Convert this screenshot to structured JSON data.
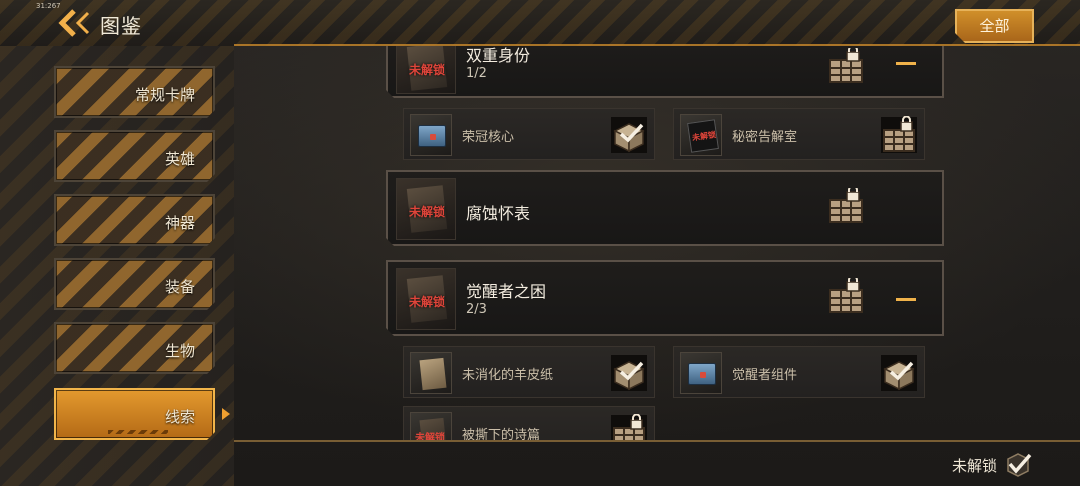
{
  "status": {
    "clock": "31:267"
  },
  "header": {
    "title": "图鉴",
    "all_button": "全部"
  },
  "sidebar": {
    "items": [
      {
        "label": "常规卡牌",
        "active": false
      },
      {
        "label": "英雄",
        "active": false
      },
      {
        "label": "神器",
        "active": false
      },
      {
        "label": "装备",
        "active": false
      },
      {
        "label": "生物",
        "active": false
      },
      {
        "label": "线索",
        "active": true
      }
    ]
  },
  "clues": {
    "cards": [
      {
        "name": "双重身份",
        "progress": "1/2",
        "thumb_label": "未解锁",
        "collapse_icon": "minus-icon",
        "box_state": "locked"
      },
      {
        "name": "腐蚀怀表",
        "progress": "",
        "thumb_label": "未解锁",
        "box_state": "locked"
      },
      {
        "name": "觉醒者之困",
        "progress": "2/3",
        "thumb_label": "未解锁",
        "collapse_icon": "minus-icon",
        "box_state": "locked"
      }
    ],
    "sub_items": [
      {
        "label": "荣冠核心",
        "state": "collected"
      },
      {
        "label": "秘密告解室",
        "state": "locked",
        "thumb_label": "未解锁"
      },
      {
        "label": "未消化的羊皮纸",
        "state": "collected"
      },
      {
        "label": "觉醒者组件",
        "state": "collected"
      },
      {
        "label": "被撕下的诗篇",
        "state": "locked",
        "thumb_label": "未解锁"
      }
    ]
  },
  "filter": {
    "label": "未解锁",
    "checked": true
  },
  "colors": {
    "accent": "#e39a2e",
    "locked_text": "#e0453a",
    "border": "#5a5047"
  }
}
